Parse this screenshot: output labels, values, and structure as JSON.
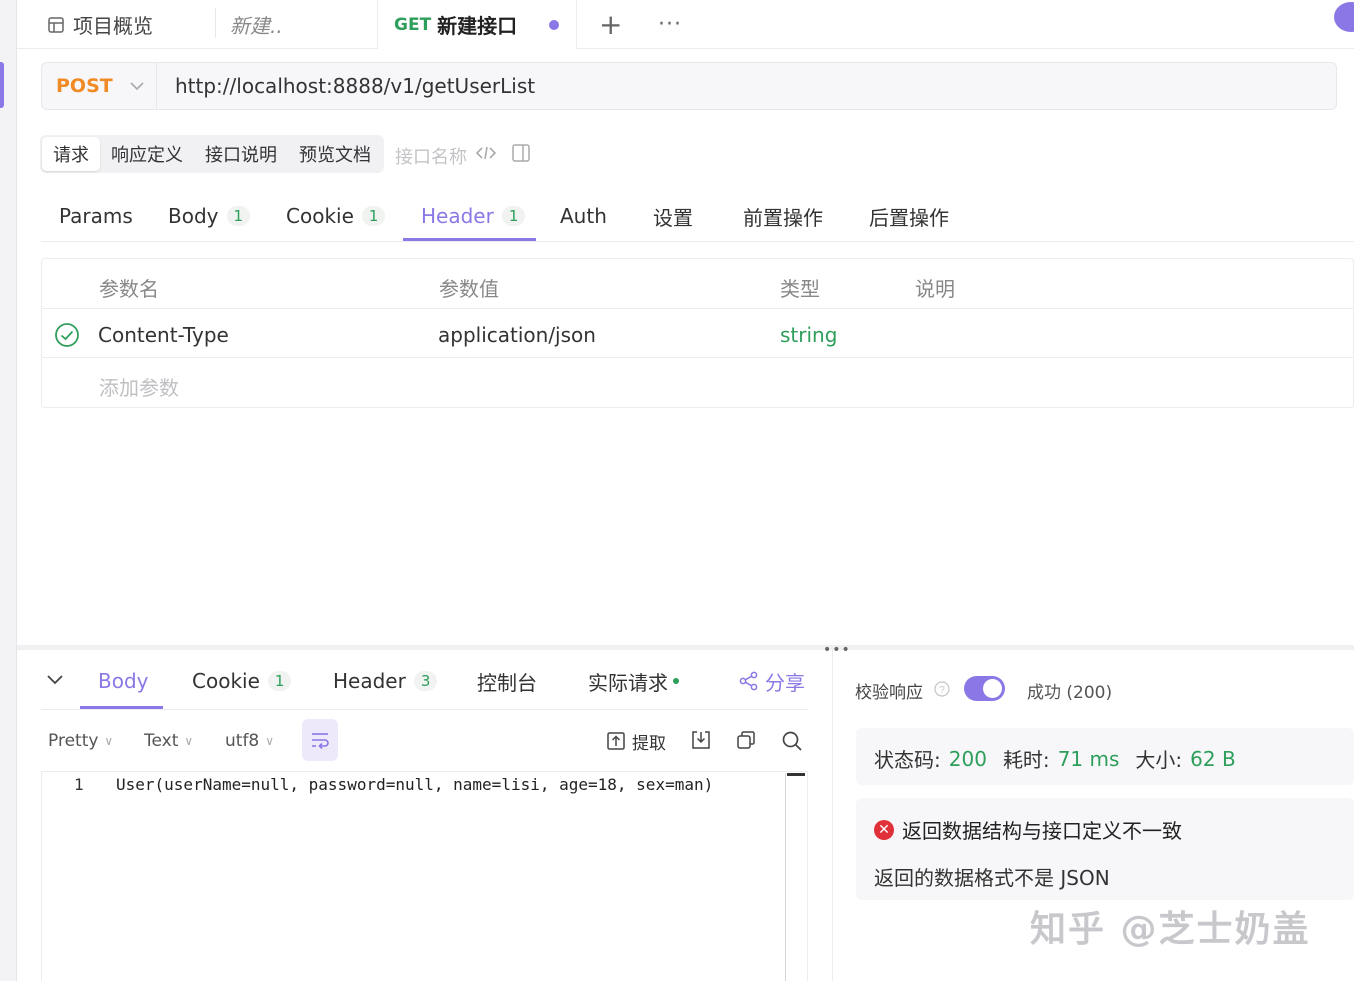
{
  "tabs": [
    {
      "label": "项目概览"
    },
    {
      "label": "新建.."
    },
    {
      "method": "GET",
      "label": "新建接口"
    }
  ],
  "url_bar": {
    "method": "POST",
    "url": "http://localhost:8888/v1/getUserList"
  },
  "segments": [
    "请求",
    "响应定义",
    "接口说明",
    "预览文档"
  ],
  "segment_hint": "接口名称",
  "request_tabs": [
    {
      "label": "Params"
    },
    {
      "label": "Body",
      "count": "1"
    },
    {
      "label": "Cookie",
      "count": "1"
    },
    {
      "label": "Header",
      "count": "1"
    },
    {
      "label": "Auth"
    },
    {
      "label": "设置"
    },
    {
      "label": "前置操作"
    },
    {
      "label": "后置操作"
    }
  ],
  "params_table": {
    "headers": [
      "参数名",
      "参数值",
      "类型",
      "说明"
    ],
    "rows": [
      {
        "name": "Content-Type",
        "value": "application/json",
        "type": "string",
        "desc": ""
      }
    ],
    "add_placeholder": "添加参数"
  },
  "response_tabs": [
    {
      "label": "Body"
    },
    {
      "label": "Cookie",
      "count": "1"
    },
    {
      "label": "Header",
      "count": "3"
    },
    {
      "label": "控制台"
    },
    {
      "label": "实际请求"
    }
  ],
  "share_label": "分享",
  "toolbar": {
    "format": "Pretty",
    "type": "Text",
    "encoding": "utf8",
    "extract": "提取"
  },
  "code": {
    "line": "1",
    "text": "User(userName=null, password=null, name=lisi, age=18, sex=man)"
  },
  "validate": {
    "label": "校验响应",
    "status": "成功 (200)"
  },
  "metrics": {
    "status_label": "状态码:",
    "status_value": "200",
    "time_label": "耗时:",
    "time_value": "71 ms",
    "size_label": "大小:",
    "size_value": "62 B"
  },
  "error": {
    "title": "返回数据结构与接口定义不一致",
    "detail": "返回的数据格式不是 JSON"
  },
  "watermark": "知乎 @芝士奶盖",
  "colors": {
    "accent": "#8b78e6",
    "post": "#f08a24",
    "get": "#2e9e5b",
    "success": "#2e9e5b",
    "error": "#e0303a"
  }
}
